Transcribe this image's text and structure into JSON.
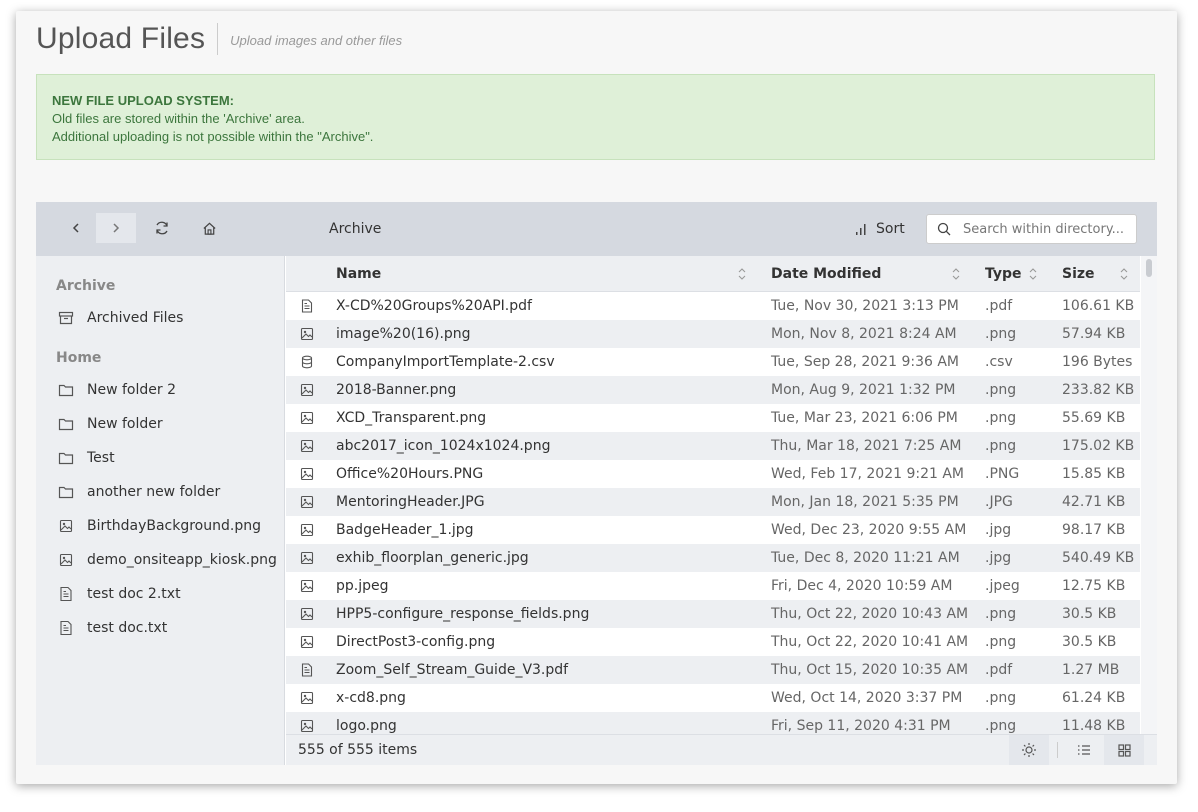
{
  "header": {
    "title": "Upload Files",
    "subtitle": "Upload images and other files"
  },
  "alert": {
    "title": "NEW FILE UPLOAD SYSTEM:",
    "line1": "Old files are stored within the 'Archive' area.",
    "line2": "Additional uploading is not possible within the \"Archive\"."
  },
  "toolbar": {
    "breadcrumb": "Archive",
    "sort_label": "Sort",
    "search_placeholder": "Search within directory..."
  },
  "sidebar": {
    "sections": [
      {
        "title": "Archive",
        "items": [
          {
            "label": "Archived Files",
            "icon": "archive-icon"
          }
        ]
      },
      {
        "title": "Home",
        "items": [
          {
            "label": "New folder 2",
            "icon": "folder-icon"
          },
          {
            "label": "New folder",
            "icon": "folder-icon"
          },
          {
            "label": "Test",
            "icon": "folder-icon"
          },
          {
            "label": "another new folder",
            "icon": "folder-icon"
          },
          {
            "label": "BirthdayBackground.png",
            "icon": "image-file-icon"
          },
          {
            "label": "demo_onsiteapp_kiosk.png",
            "icon": "image-file-icon"
          },
          {
            "label": "test doc 2.txt",
            "icon": "text-file-icon"
          },
          {
            "label": "test doc.txt",
            "icon": "text-file-icon"
          }
        ]
      }
    ]
  },
  "grid": {
    "columns": {
      "name": "Name",
      "date": "Date Modified",
      "type": "Type",
      "size": "Size"
    },
    "rows": [
      {
        "icon": "pdf-file-icon",
        "name": "X-CD%20Groups%20API.pdf",
        "date": "Tue, Nov 30, 2021 3:13 PM",
        "type": ".pdf",
        "size": "106.61 KB"
      },
      {
        "icon": "image-file-icon",
        "name": "image%20(16).png",
        "date": "Mon, Nov 8, 2021 8:24 AM",
        "type": ".png",
        "size": "57.94 KB"
      },
      {
        "icon": "database-icon",
        "name": "CompanyImportTemplate-2.csv",
        "date": "Tue, Sep 28, 2021 9:36 AM",
        "type": ".csv",
        "size": "196 Bytes"
      },
      {
        "icon": "image-file-icon",
        "name": "2018-Banner.png",
        "date": "Mon, Aug 9, 2021 1:32 PM",
        "type": ".png",
        "size": "233.82 KB"
      },
      {
        "icon": "image-file-icon",
        "name": "XCD_Transparent.png",
        "date": "Tue, Mar 23, 2021 6:06 PM",
        "type": ".png",
        "size": "55.69 KB"
      },
      {
        "icon": "image-file-icon",
        "name": "abc2017_icon_1024x1024.png",
        "date": "Thu, Mar 18, 2021 7:25 AM",
        "type": ".png",
        "size": "175.02 KB"
      },
      {
        "icon": "image-file-icon",
        "name": "Office%20Hours.PNG",
        "date": "Wed, Feb 17, 2021 9:21 AM",
        "type": ".PNG",
        "size": "15.85 KB"
      },
      {
        "icon": "image-file-icon",
        "name": "MentoringHeader.JPG",
        "date": "Mon, Jan 18, 2021 5:35 PM",
        "type": ".JPG",
        "size": "42.71 KB"
      },
      {
        "icon": "image-file-icon",
        "name": "BadgeHeader_1.jpg",
        "date": "Wed, Dec 23, 2020 9:55 AM",
        "type": ".jpg",
        "size": "98.17 KB"
      },
      {
        "icon": "image-file-icon",
        "name": "exhib_floorplan_generic.jpg",
        "date": "Tue, Dec 8, 2020 11:21 AM",
        "type": ".jpg",
        "size": "540.49 KB"
      },
      {
        "icon": "image-file-icon",
        "name": "pp.jpeg",
        "date": "Fri, Dec 4, 2020 10:59 AM",
        "type": ".jpeg",
        "size": "12.75 KB"
      },
      {
        "icon": "image-file-icon",
        "name": "HPP5-configure_response_fields.png",
        "date": "Thu, Oct 22, 2020 10:43 AM",
        "type": ".png",
        "size": "30.5 KB"
      },
      {
        "icon": "image-file-icon",
        "name": "DirectPost3-config.png",
        "date": "Thu, Oct 22, 2020 10:41 AM",
        "type": ".png",
        "size": "30.5 KB"
      },
      {
        "icon": "pdf-file-icon",
        "name": "Zoom_Self_Stream_Guide_V3.pdf",
        "date": "Thu, Oct 15, 2020 10:35 AM",
        "type": ".pdf",
        "size": "1.27 MB"
      },
      {
        "icon": "image-file-icon",
        "name": "x-cd8.png",
        "date": "Wed, Oct 14, 2020 3:37 PM",
        "type": ".png",
        "size": "61.24 KB"
      },
      {
        "icon": "image-file-icon",
        "name": "logo.png",
        "date": "Fri, Sep 11, 2020 4:31 PM",
        "type": ".png",
        "size": "11.48 KB"
      }
    ]
  },
  "status": {
    "count_text": "555 of 555 items"
  }
}
